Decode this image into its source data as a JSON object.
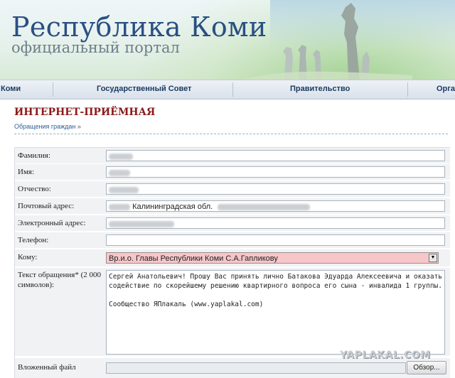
{
  "header": {
    "title": "Республика Коми",
    "subtitle": "официальный портал"
  },
  "nav": {
    "items": [
      {
        "label": "Коми"
      },
      {
        "label": "Государственный Совет"
      },
      {
        "label": "Правительство"
      },
      {
        "label": "Орга"
      }
    ]
  },
  "page": {
    "title": "ИНТЕРНЕТ-ПРИЁМНАЯ",
    "breadcrumb": "Обращения граждан",
    "breadcrumb_arrow": "»"
  },
  "form": {
    "surname_label": "Фамилия:",
    "name_label": "Имя:",
    "patronymic_label": "Отчество:",
    "address_label": "Почтовый адрес:",
    "address_value": "Калининградская обл.",
    "email_label": "Электронный адрес:",
    "phone_label": "Телефон:",
    "to_label": "Кому:",
    "to_value": "Вр.и.о. Главы Республики Коми С.А.Гапликову",
    "message_label": "Текст обращения* (2 000 символов):",
    "message_value": "Сергей Анатольевич! Прошу Вас принять лично Батакова Эдуарда Алексеевича и оказать\nсодействие по скорейшему решению квартирного вопроса его сына - инвалида 1 группы.\n\nСообщество ЯПлакаль (www.yaplakal.com)",
    "file_label": "Вложенный файл",
    "browse_label": "Обзор..."
  },
  "watermark": "YAPLAKAL.COM",
  "colors": {
    "title": "#2a4f84",
    "page_title": "#8b1a1a",
    "select_bg": "#f7c6c9",
    "link": "#2c5d9a"
  }
}
